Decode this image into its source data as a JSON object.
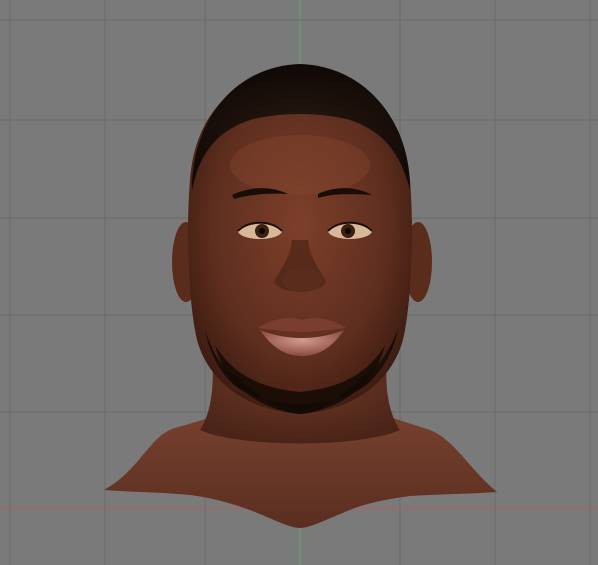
{
  "viewport": {
    "name": "3D Viewport",
    "background_color": "#7a7a7a",
    "grid_line_color": "#6a6a6a",
    "x_axis_color": "#b85a5a",
    "y_axis_color": "#5faa5f",
    "grid_visible": true
  },
  "model": {
    "type": "head-bust",
    "skin_color": "#6e3826",
    "shadow_color": "#3a1a10",
    "hair_color": "#1a1008",
    "lip_color": "#b06b5e"
  }
}
